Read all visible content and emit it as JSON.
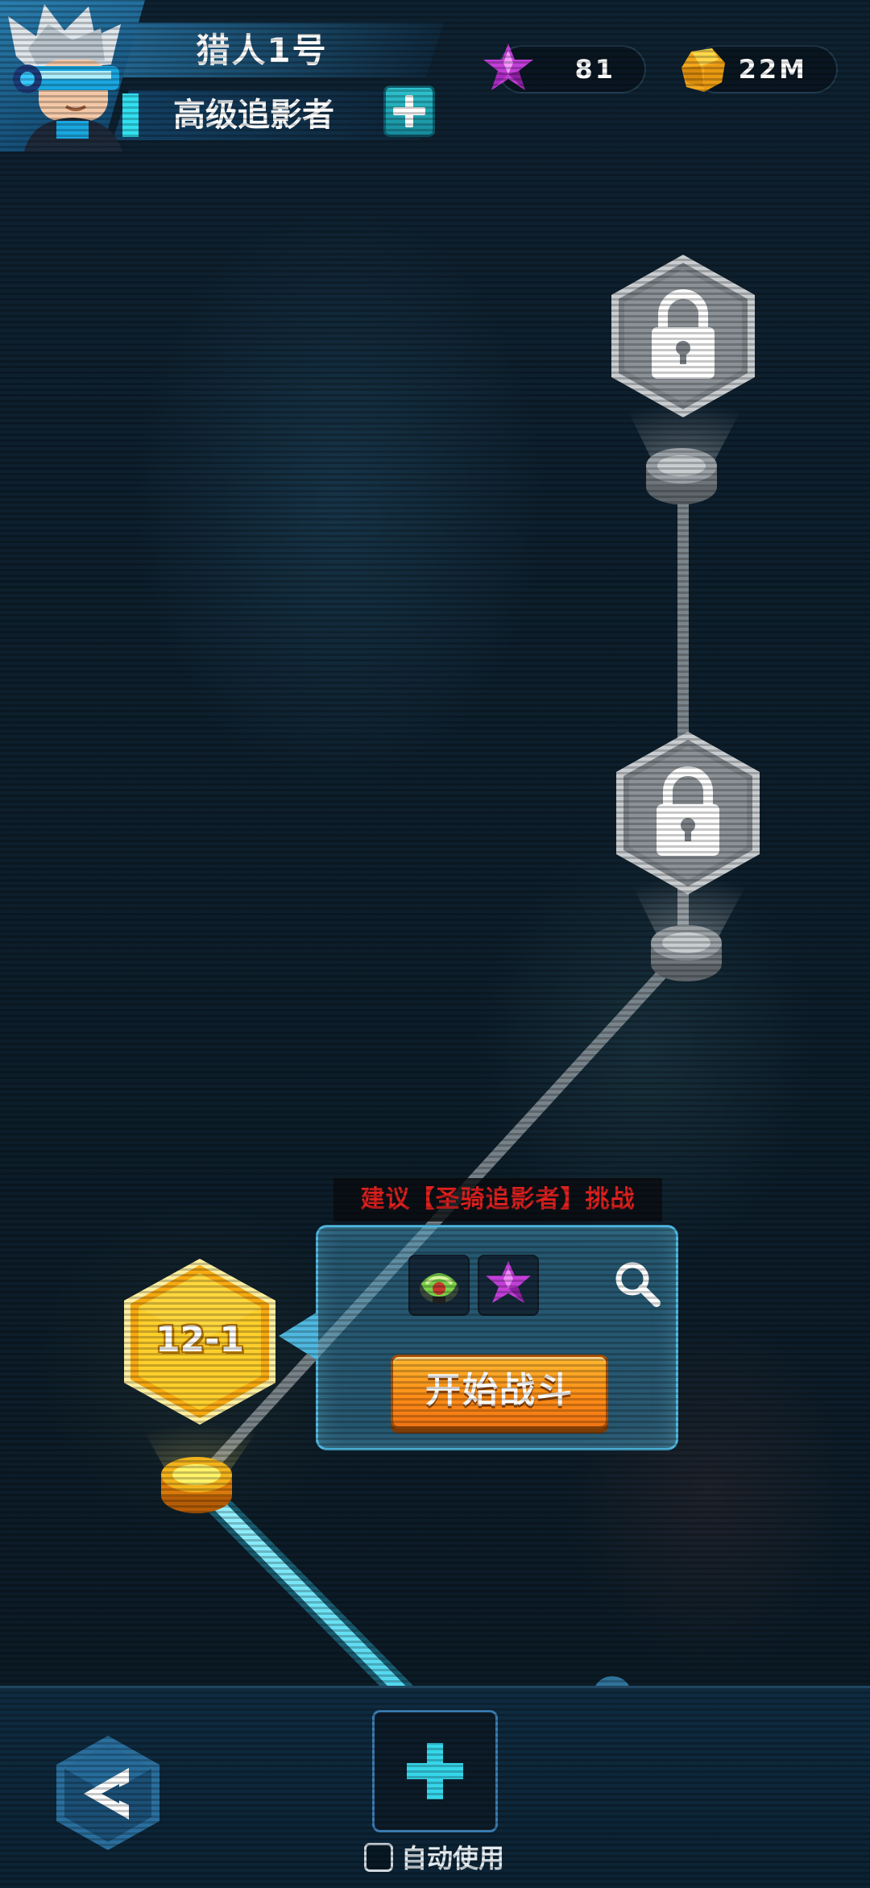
{
  "player": {
    "name": "猎人1号",
    "title": "高级追影者"
  },
  "currencies": {
    "gems": "81",
    "gold": "22M"
  },
  "map": {
    "current_level": "12-1",
    "locked_levels_count": 2
  },
  "popup": {
    "advice": "建议【圣骑追影者】挑战",
    "start_button": "开始战斗",
    "rewards": [
      "equipment-item-icon",
      "purple-star-gem-icon"
    ]
  },
  "bottom": {
    "auto_use_label": "自动使用",
    "auto_use_checked": false
  },
  "colors": {
    "current_level": "#ffc21a",
    "path_active": "#5fe4f7",
    "start_button": "#ff8f17",
    "advice_text": "#e0201e"
  }
}
